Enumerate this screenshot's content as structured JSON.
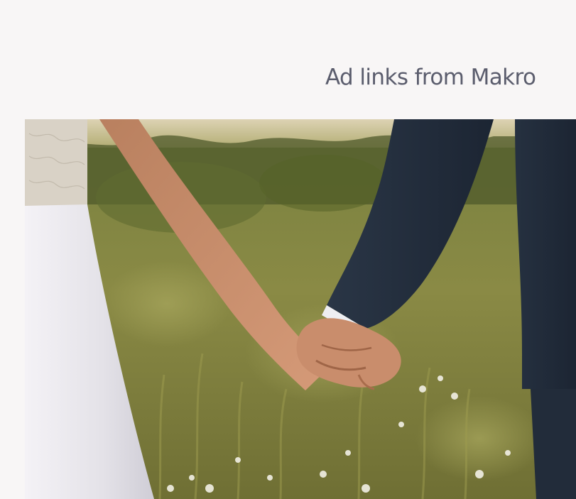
{
  "ad": {
    "header_text": "Ad links from Makro",
    "image_subject": "couple-holding-hands-photo",
    "colors": {
      "page_background": "#f8f6f6",
      "header_text": "#5b5d6d",
      "meadow_green": "#6f7a36",
      "dress_white": "#eceaee",
      "suit_navy": "#253040",
      "skin": "#c98d6c"
    }
  }
}
